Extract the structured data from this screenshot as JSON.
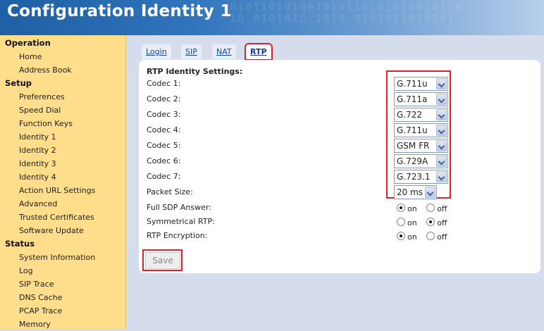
{
  "header": {
    "title": "Configuration Identity 1",
    "binary_lines": [
      "010110101001010110101010010110",
      "10 0101010 1010 0101011010101"
    ]
  },
  "sidebar": {
    "sections": [
      {
        "title": "Operation",
        "items": [
          "Home",
          "Address Book"
        ]
      },
      {
        "title": "Setup",
        "items": [
          "Preferences",
          "Speed Dial",
          "Function Keys",
          "Identity 1",
          "Identity 2",
          "Identity 3",
          "Identity 4",
          "Action URL Settings",
          "Advanced",
          "Trusted Certificates",
          "Software Update"
        ]
      },
      {
        "title": "Status",
        "items": [
          "System Information",
          "Log",
          "SIP Trace",
          "DNS Cache",
          "PCAP Trace",
          "Memory"
        ]
      }
    ]
  },
  "tabs": [
    {
      "label": "Login"
    },
    {
      "label": "SIP"
    },
    {
      "label": "NAT"
    },
    {
      "label": "RTP"
    }
  ],
  "form": {
    "section_title": "RTP Identity Settings:",
    "codecs": [
      {
        "label": "Codec 1:",
        "value": "G.711u"
      },
      {
        "label": "Codec 2:",
        "value": "G.711a"
      },
      {
        "label": "Codec 3:",
        "value": "G.722"
      },
      {
        "label": "Codec 4:",
        "value": "G.711u"
      },
      {
        "label": "Codec 5:",
        "value": "GSM FR"
      },
      {
        "label": "Codec 6:",
        "value": "G.729A"
      },
      {
        "label": "Codec 7:",
        "value": "G.723.1"
      }
    ],
    "packet_size": {
      "label": "Packet Size:",
      "value": "20 ms"
    },
    "radios": [
      {
        "label": "Full SDP Answer:",
        "on": "on",
        "off": "off",
        "selected": "on"
      },
      {
        "label": "Symmetrical RTP:",
        "on": "on",
        "off": "off",
        "selected": "off"
      },
      {
        "label": "RTP Encryption:",
        "on": "on",
        "off": "off",
        "selected": "on"
      }
    ],
    "save_label": "Save"
  },
  "colors": {
    "sidebar_bg": "#fede8a",
    "highlight": "#dd1f2b",
    "link": "#1144bb",
    "page_bg": "#d5dcec"
  }
}
